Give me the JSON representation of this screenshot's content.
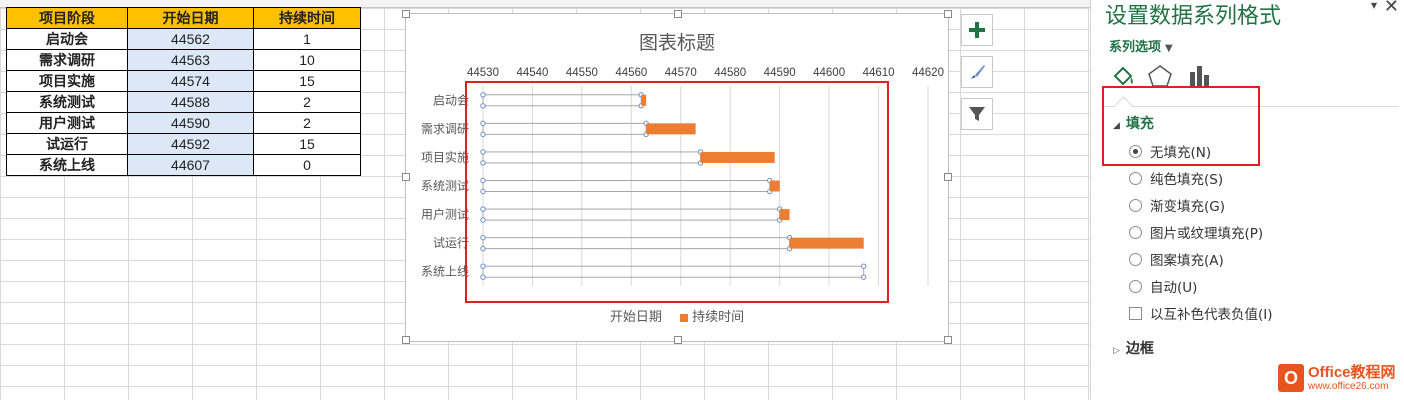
{
  "sheet": {
    "headers": [
      "项目阶段",
      "开始日期",
      "持续时间"
    ],
    "rows": [
      [
        "启动会",
        "44562",
        "1"
      ],
      [
        "需求调研",
        "44563",
        "10"
      ],
      [
        "项目实施",
        "44574",
        "15"
      ],
      [
        "系统测试",
        "44588",
        "2"
      ],
      [
        "用户测试",
        "44590",
        "2"
      ],
      [
        "试运行",
        "44592",
        "15"
      ],
      [
        "系统上线",
        "44607",
        "0"
      ]
    ]
  },
  "chart_data": {
    "type": "bar",
    "orientation": "horizontal-stacked",
    "title": "图表标题",
    "categories": [
      "启动会",
      "需求调研",
      "项目实施",
      "系统测试",
      "用户测试",
      "试运行",
      "系统上线"
    ],
    "series": [
      {
        "name": "开始日期",
        "values": [
          44562,
          44563,
          44574,
          44588,
          44590,
          44592,
          44607
        ],
        "fill": "none"
      },
      {
        "name": "持续时间",
        "values": [
          1,
          10,
          15,
          2,
          2,
          15,
          0
        ],
        "color": "#ed7d31"
      }
    ],
    "x_ticks": [
      "44530",
      "44540",
      "44550",
      "44560",
      "44570",
      "44580",
      "44590",
      "44600",
      "44610",
      "44620"
    ],
    "xlim": [
      44530,
      44620
    ],
    "x_axis_position": "top",
    "legend_position": "bottom"
  },
  "pane": {
    "title": "设置数据系列格式",
    "series_options": "系列选项",
    "fill_section": "填充",
    "fill_options": [
      "无填充(N)",
      "纯色填充(S)",
      "渐变填充(G)",
      "图片或纹理填充(P)",
      "图案填充(A)",
      "自动(U)"
    ],
    "selected_index": 0,
    "invert_label": "以互补色代表负值(I)",
    "border_section": "边框"
  },
  "watermark": {
    "line1": "Office教程网",
    "line2": "www.office26.com"
  },
  "colors": {
    "accent": "#217346",
    "bar": "#ed7d31",
    "highlight": "#e02020",
    "header_fill": "#ffc000"
  }
}
